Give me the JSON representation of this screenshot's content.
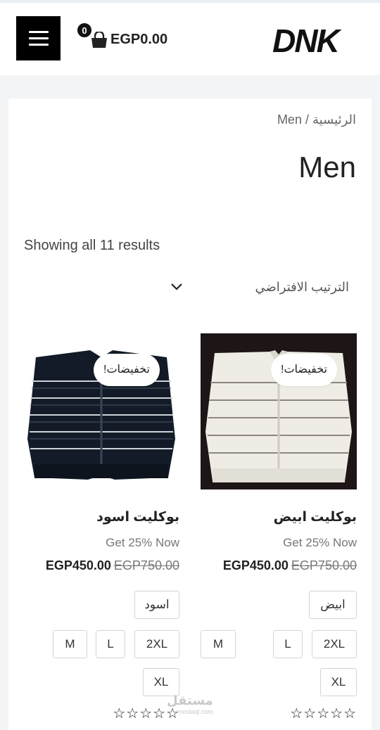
{
  "header": {
    "menu_label": "Menu",
    "cart_count": "0",
    "cart_total": "EGP0.00",
    "logo_text": "DNK"
  },
  "breadcrumb": {
    "home": "الرئيسية",
    "separator": "/",
    "current": "Men"
  },
  "page_title": "Men",
  "results_text": "Showing all 11 results",
  "sort": {
    "selected": "الترتيب الافتراضي"
  },
  "products": [
    {
      "name": "بوكليت ابيض",
      "sale_badge": "تخفيضات!",
      "promo": "Get 25% Now",
      "price_new": "EGP450.00",
      "price_old": "EGP750.00",
      "color_option": "ابيض",
      "sizes": [
        "M",
        "L",
        "2XL",
        "XL"
      ],
      "rating_stars": "☆☆☆☆☆",
      "image_background": "#1e1616"
    },
    {
      "name": "بوكليت اسود",
      "sale_badge": "تخفيضات!",
      "promo": "Get 25% Now",
      "price_new": "EGP450.00",
      "price_old": "EGP750.00",
      "color_option": "اسود",
      "sizes": [
        "M",
        "L",
        "2XL",
        "XL"
      ],
      "rating_stars": "☆☆☆☆☆",
      "image_background": "#ffffff"
    }
  ],
  "watermark": {
    "text": "مستقل",
    "sub": "mostaql.com"
  },
  "colors": {
    "header_bg": "#ffffff",
    "page_bg": "#f3f4f6",
    "menu_button": "#000000",
    "accent_text": "#222222"
  }
}
